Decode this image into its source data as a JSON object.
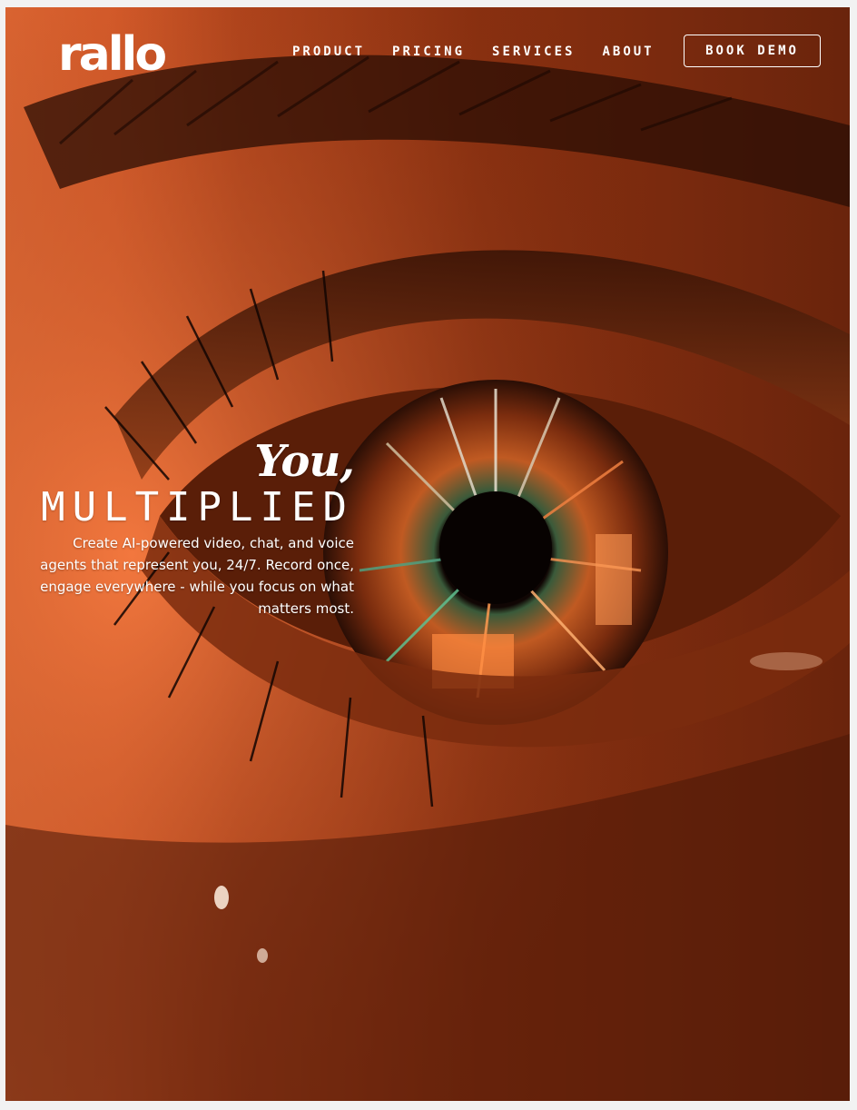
{
  "site": {
    "logo_text": "rallo"
  },
  "nav": {
    "items": [
      {
        "label": "PRODUCT"
      },
      {
        "label": "PRICING"
      },
      {
        "label": "SERVICES"
      },
      {
        "label": "ABOUT"
      }
    ],
    "cta_label": "BOOK DEMO"
  },
  "hero": {
    "title_line1": "You,",
    "title_line2": "MULTIPLIED",
    "description": "Create AI-powered video, chat, and voice agents that represent you, 24/7. Record once, engage everywhere - while you focus on what matters most.",
    "background_image": "close-up-eye-orange-tint"
  },
  "colors": {
    "accent": "#e8632e",
    "text": "#ffffff",
    "frame_border": "#d0d0d0"
  }
}
